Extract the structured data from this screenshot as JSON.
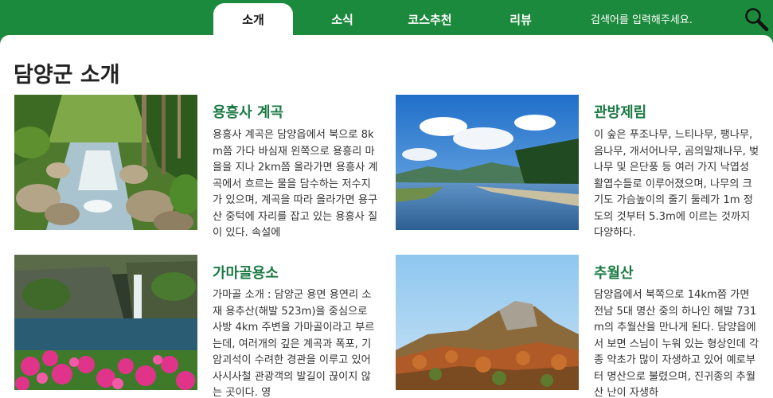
{
  "nav": {
    "tabs": [
      {
        "label": "소개"
      },
      {
        "label": "소식"
      },
      {
        "label": "코스추천"
      },
      {
        "label": "리뷰"
      }
    ],
    "search_placeholder": "검색어를 입력해주세요."
  },
  "page": {
    "title": "담양군 소개"
  },
  "cards": [
    {
      "title": "용흥사 계곡",
      "desc": "용흥사 계곡은 담양읍에서 북으로 8km쯤 가다 바심재 왼쪽으로 용흥리 마을을 지나 2km쯤 올라가면 용흥사 계곡에서 흐르는 물을 담수하는 저수지가 있으며, 계곡을 따라 올라가면 용구산 중턱에 자리를 잡고 있는 용흥사 질이 있다. 속설에"
    },
    {
      "title": "관방제림",
      "desc": "이 숲은 푸조나무, 느티나무, 팽나무, 음나무, 개서어나무, 곰의말채나무, 벚나무 및 은단풍 등 여러 가지 낙엽성 활엽수들로 이루어졌으며, 나무의 크기도 가슴높이의 줄기 둘레가 1m 정도의 것부터 5.3m에 이르는 것까지 다양하다."
    },
    {
      "title": "가마골용소",
      "desc": "가마골 소개 : 담양군 용면 용연리 소재 용추산(해발 523m)을 중심으로 사방 4km 주변을 가마골이라고 부르는데, 여러개의 깊은 계곡과 폭포, 기암괴석이 수려한 경관을 이루고 있어 사시사철 관광객의 발길이 끊이지 않는 곳이다. 영"
    },
    {
      "title": "추월산",
      "desc": "담양읍에서 북쪽으로 14km쯤 가면 전남 5대 명산 중의 하나인 해발 731m의 추월산을 만나게 된다. 담양읍에서 보면 스님이 누워 있는 형상인데 각종 약초가 많이 자생하고 있어 예로부터 명산으로 불렸으며, 진귀종의 추월산 난이 자생하"
    }
  ],
  "colors": {
    "brand_green": "#1c8a3c",
    "title_green": "#1b7a44"
  }
}
